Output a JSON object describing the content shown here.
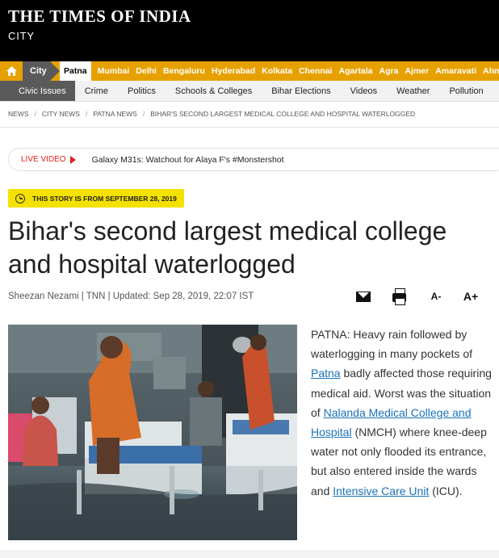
{
  "masthead": {
    "logo": "THE TIMES OF INDIA",
    "section": "CITY"
  },
  "citybar": {
    "home_icon": "home-icon",
    "city_tab": "City",
    "cities": [
      "Patna",
      "Mumbai",
      "Delhi",
      "Bengaluru",
      "Hyderabad",
      "Kolkata",
      "Chennai",
      "Agartala",
      "Agra",
      "Ajmer",
      "Amaravati",
      "Ahmedabad"
    ],
    "active_city": "Patna",
    "accent": "#e6a100"
  },
  "subnav": {
    "items": [
      "Civic Issues",
      "Crime",
      "Politics",
      "Schools & Colleges",
      "Bihar Elections",
      "Videos",
      "Weather",
      "Pollution"
    ],
    "active": "Civic Issues"
  },
  "breadcrumb": [
    "NEWS",
    "CITY NEWS",
    "PATNA NEWS",
    "BIHAR'S SECOND LARGEST MEDICAL COLLEGE AND HOSPITAL WATERLOGGED"
  ],
  "live": {
    "label": "LIVE VIDEO",
    "text": "Galaxy M31s: Watchout for Alaya F's #Monstershot",
    "color": "#e0201f"
  },
  "date_badge": {
    "text": "THIS STORY IS FROM SEPTEMBER 28, 2019",
    "icon": "clock-icon",
    "color": "#f4e100"
  },
  "article": {
    "headline": "Bihar's second largest medical college and hospital waterlogged",
    "byline": "Sheezan Nezami | TNN | Updated: Sep 28, 2019, 22:07 IST",
    "tools": {
      "mail_icon": "mail-icon",
      "print_icon": "print-icon",
      "font_decrease": "A-",
      "font_increase": "A+"
    },
    "body": {
      "p1": "PATNA: Heavy rain followed by waterlogging in many pockets of ",
      "link_patna": "Patna",
      "p2": " badly affected those requiring medical aid. Worst was the situation of ",
      "link_nmch": "Nalanda Medical College and Hospital",
      "p3": " (NMCH) where knee-deep water not only flooded its entrance, but also entered inside the wards and ",
      "link_icu": "Intensive Care Unit",
      "p4": " (ICU).",
      "link_color": "#1a72b8"
    }
  }
}
